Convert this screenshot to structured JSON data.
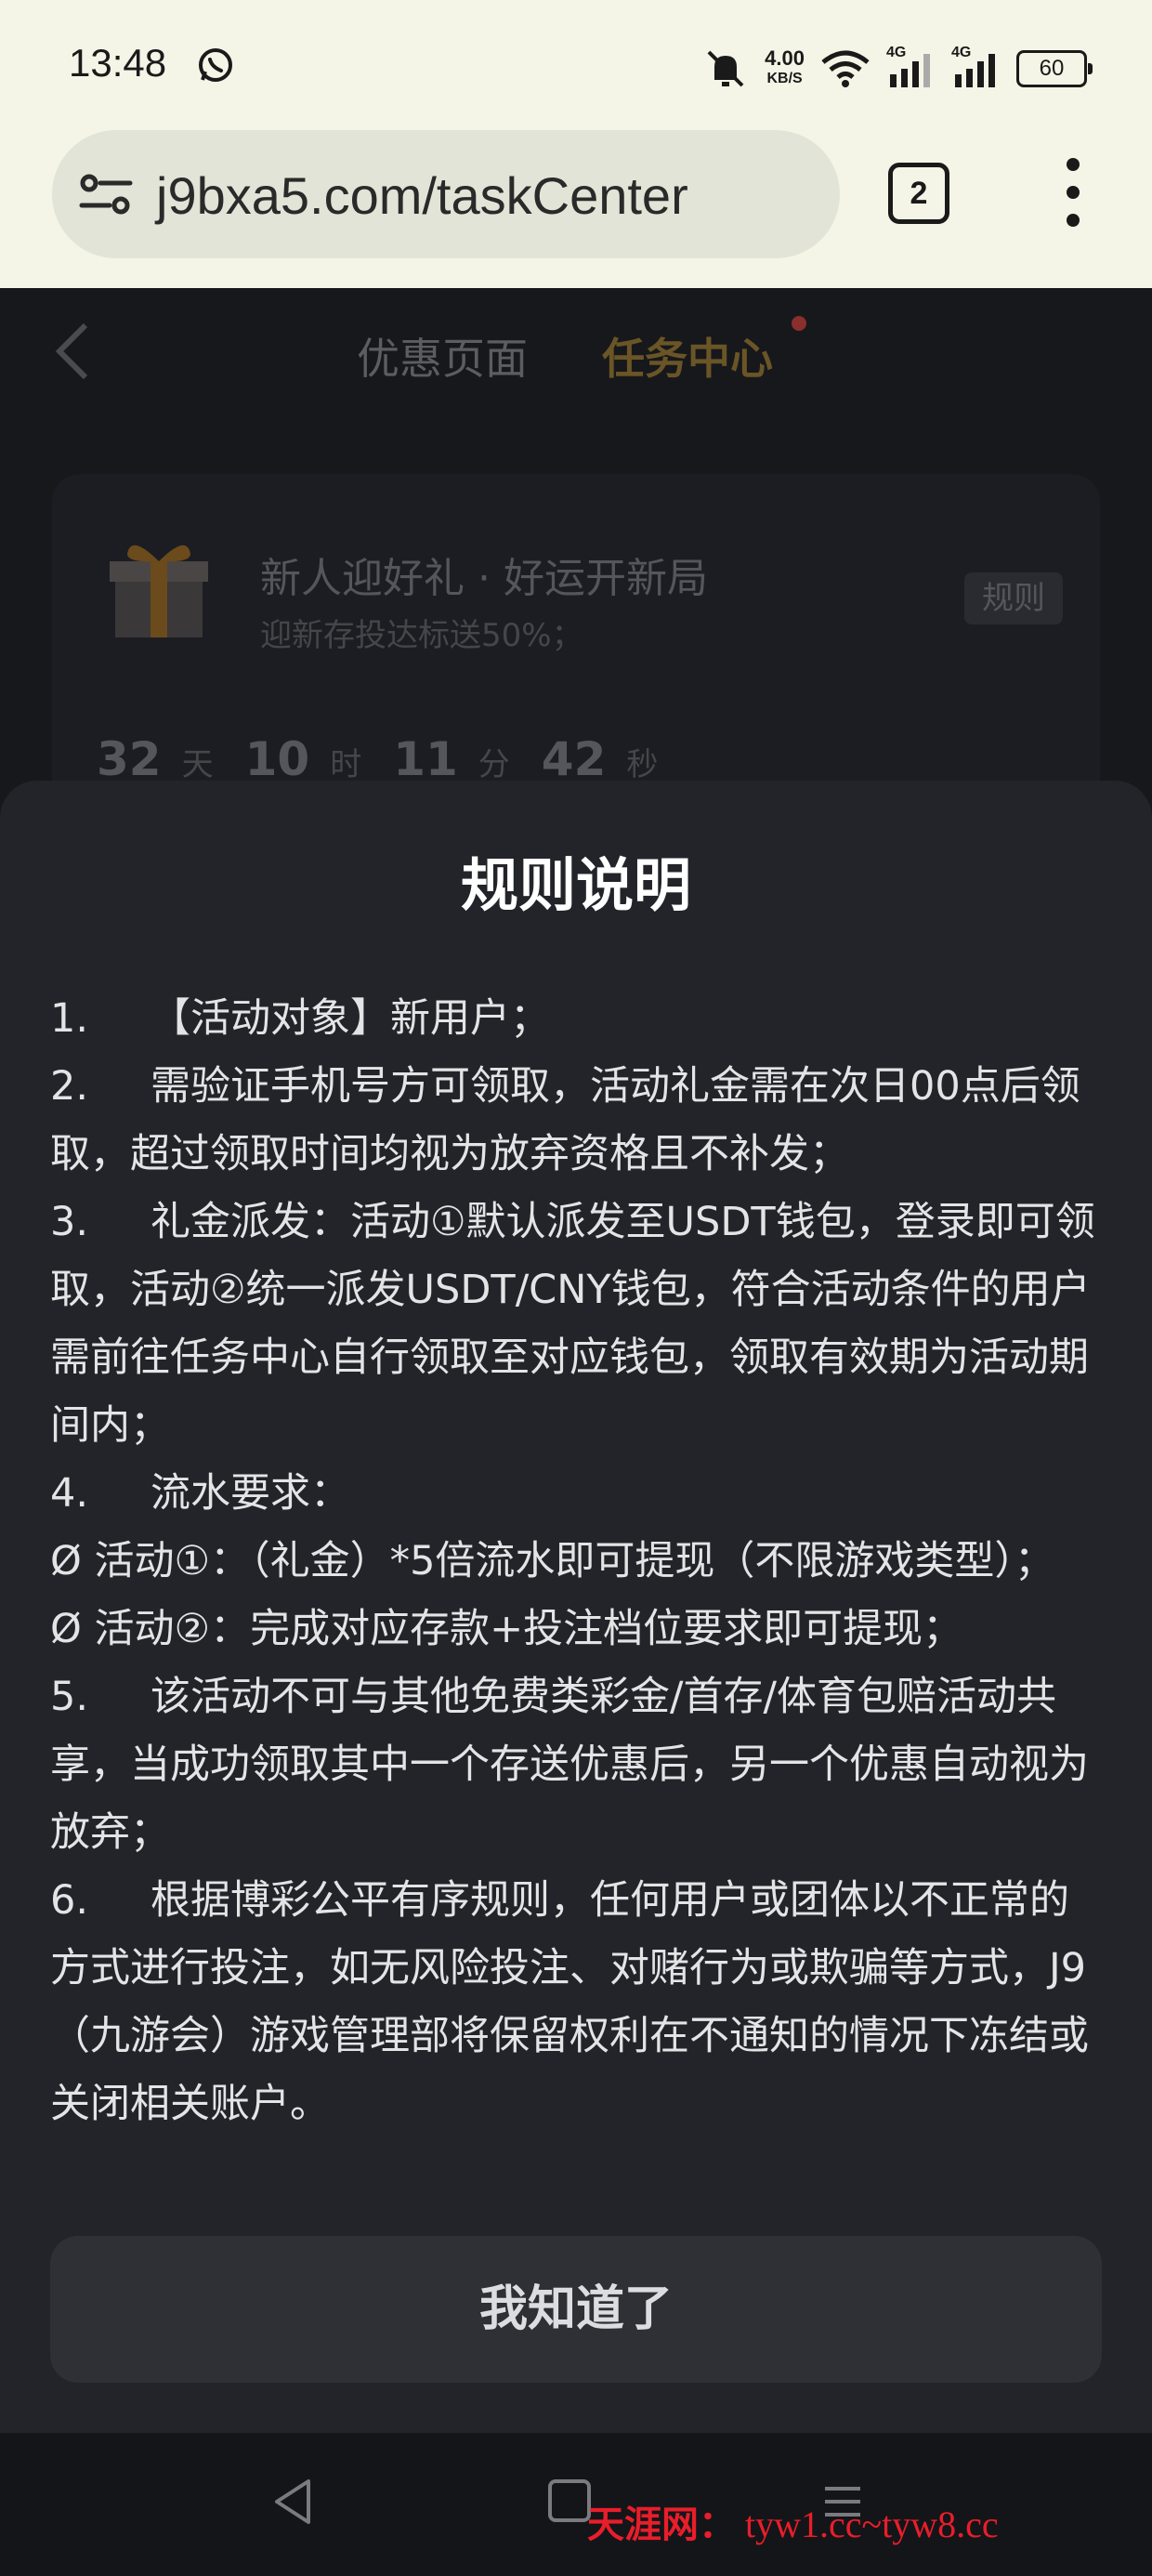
{
  "status_bar": {
    "time": "13:48",
    "net_speed": "4.00",
    "net_unit": "KB/S",
    "signal_1": "4G",
    "signal_2": "4G",
    "battery": "60"
  },
  "browser": {
    "url": "j9bxa5.com/taskCenter",
    "tab_count": "2"
  },
  "page_header": {
    "tab_promo": "优惠页面",
    "tab_task": "任务中心"
  },
  "task_card": {
    "title": "新人迎好礼 · 好运开新局",
    "subtitle": "迎新存投达标送50%；",
    "rule_button": "规则",
    "countdown": [
      {
        "value": "32",
        "unit": "天"
      },
      {
        "value": "10",
        "unit": "时"
      },
      {
        "value": "11",
        "unit": "分"
      },
      {
        "value": "42",
        "unit": "秒"
      }
    ]
  },
  "modal": {
    "title": "规则说明",
    "rules": [
      {
        "num": "1.",
        "text": "【活动对象】新用户；"
      },
      {
        "num": "2.",
        "text": "需验证手机号方可领取，活动礼金需在次日00点后领取，超过领取时间均视为放弃资格且不补发；"
      },
      {
        "num": "3.",
        "text": "礼金派发：活动①默认派发至USDT钱包，登录即可领取，活动②统一派发USDT/CNY钱包，符合活动条件的用户需前往任务中心自行领取至对应钱包，领取有效期为活动期间内；"
      },
      {
        "num": "4.",
        "text": "流水要求："
      },
      {
        "num": "",
        "text": "Ø  活动①：（礼金）*5倍流水即可提现（不限游戏类型）；"
      },
      {
        "num": "",
        "text": "Ø  活动②：完成对应存款+投注档位要求即可提现；"
      },
      {
        "num": "5.",
        "text": "该活动不可与其他免费类彩金/首存/体育包赔活动共享，当成功领取其中一个存送优惠后，另一个优惠自动视为放弃；"
      },
      {
        "num": "6.",
        "text": "根据博彩公平有序规则，任何用户或团体以不正常的方式进行投注，如无风险投注、对赌行为或欺骗等方式，J9（九游会）游戏管理部将保留权利在不通知的情况下冻结或关闭相关账户。"
      }
    ],
    "confirm_button": "我知道了"
  },
  "watermark": {
    "cn": "天涯网：",
    "url": "tyw1.cc~tyw8.cc"
  }
}
